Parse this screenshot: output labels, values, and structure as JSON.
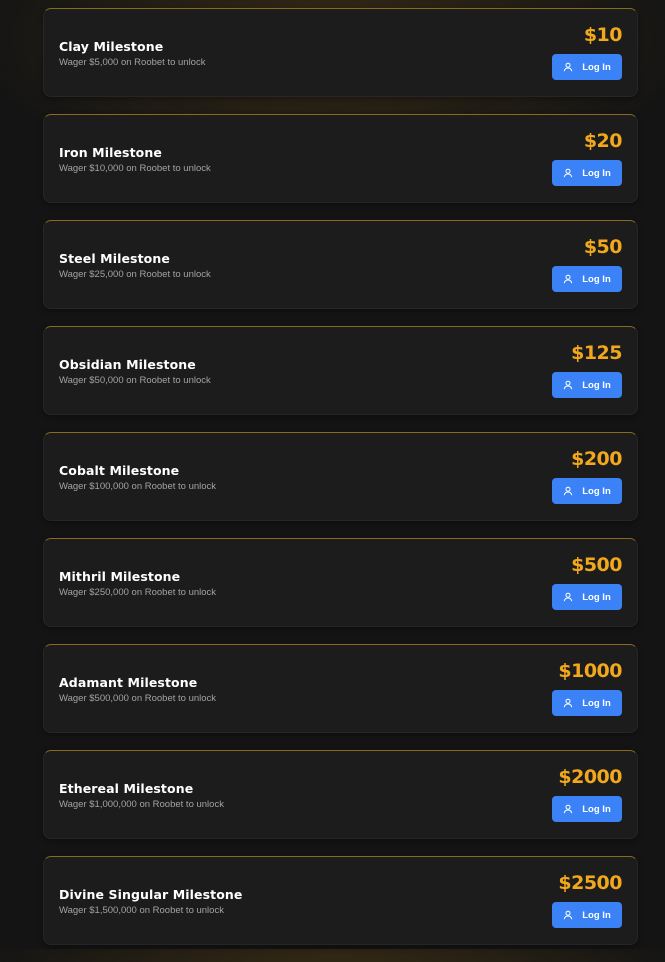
{
  "accent_color": "#f2a81d",
  "button_color": "#3b82f6",
  "milestones": [
    {
      "title": "Clay Milestone",
      "subtitle": "Wager $5,000 on Roobet to unlock",
      "amount": "$10",
      "button_label": "Log In",
      "button_icon": "user-icon"
    },
    {
      "title": "Iron Milestone",
      "subtitle": "Wager $10,000 on Roobet to unlock",
      "amount": "$20",
      "button_label": "Log In",
      "button_icon": "user-icon"
    },
    {
      "title": "Steel Milestone",
      "subtitle": "Wager $25,000 on Roobet to unlock",
      "amount": "$50",
      "button_label": "Log In",
      "button_icon": "user-icon"
    },
    {
      "title": "Obsidian Milestone",
      "subtitle": "Wager $50,000 on Roobet to unlock",
      "amount": "$125",
      "button_label": "Log In",
      "button_icon": "user-icon"
    },
    {
      "title": "Cobalt Milestone",
      "subtitle": "Wager $100,000 on Roobet to unlock",
      "amount": "$200",
      "button_label": "Log In",
      "button_icon": "user-icon"
    },
    {
      "title": "Mithril Milestone",
      "subtitle": "Wager $250,000 on Roobet to unlock",
      "amount": "$500",
      "button_label": "Log In",
      "button_icon": "user-icon"
    },
    {
      "title": "Adamant Milestone",
      "subtitle": "Wager $500,000 on Roobet to unlock",
      "amount": "$1000",
      "button_label": "Log In",
      "button_icon": "user-icon"
    },
    {
      "title": "Ethereal Milestone",
      "subtitle": "Wager $1,000,000 on Roobet to unlock",
      "amount": "$2000",
      "button_label": "Log In",
      "button_icon": "user-icon"
    },
    {
      "title": "Divine Singular Milestone",
      "subtitle": "Wager $1,500,000 on Roobet to unlock",
      "amount": "$2500",
      "button_label": "Log In",
      "button_icon": "user-icon"
    }
  ]
}
